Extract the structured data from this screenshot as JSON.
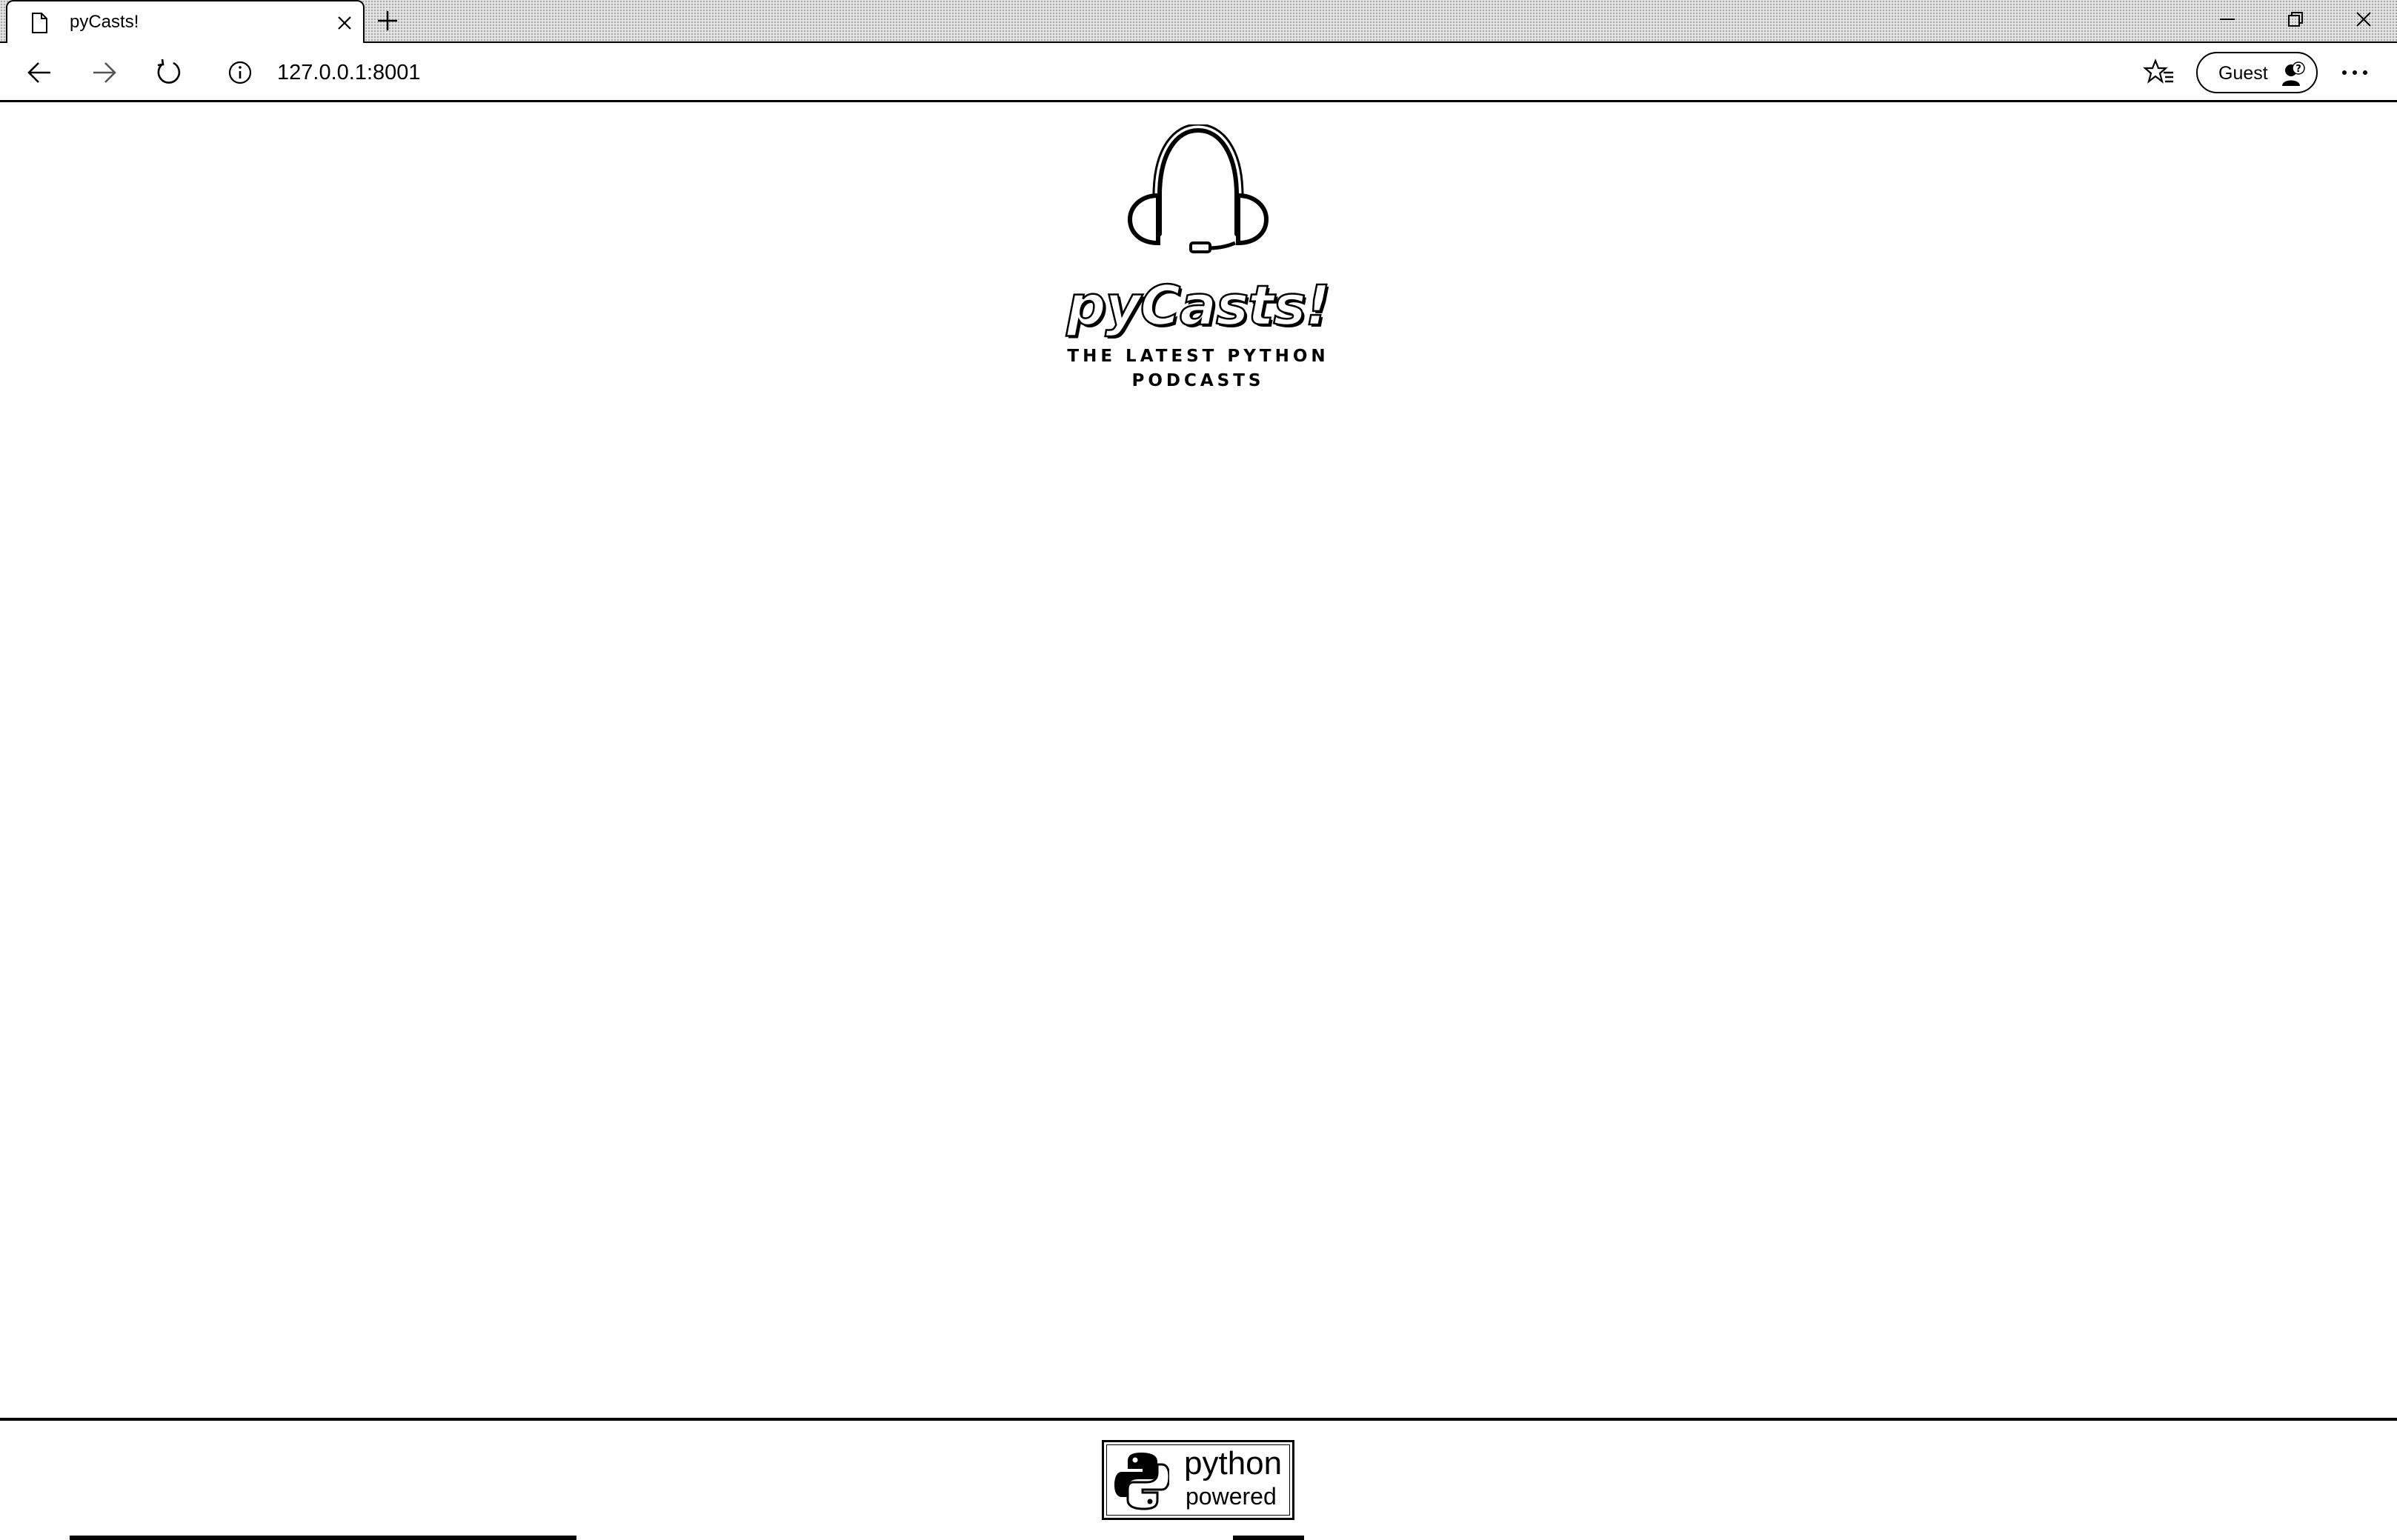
{
  "browser": {
    "tab": {
      "title": "pyCasts!"
    },
    "address": {
      "url": "127.0.0.1:8001"
    },
    "profile": {
      "label": "Guest"
    }
  },
  "page": {
    "logo": {
      "title": "pyCasts!",
      "tagline": "THE LATEST PYTHON PODCASTS"
    },
    "footer": {
      "badge_line1": "python",
      "badge_line2": "powered"
    }
  }
}
